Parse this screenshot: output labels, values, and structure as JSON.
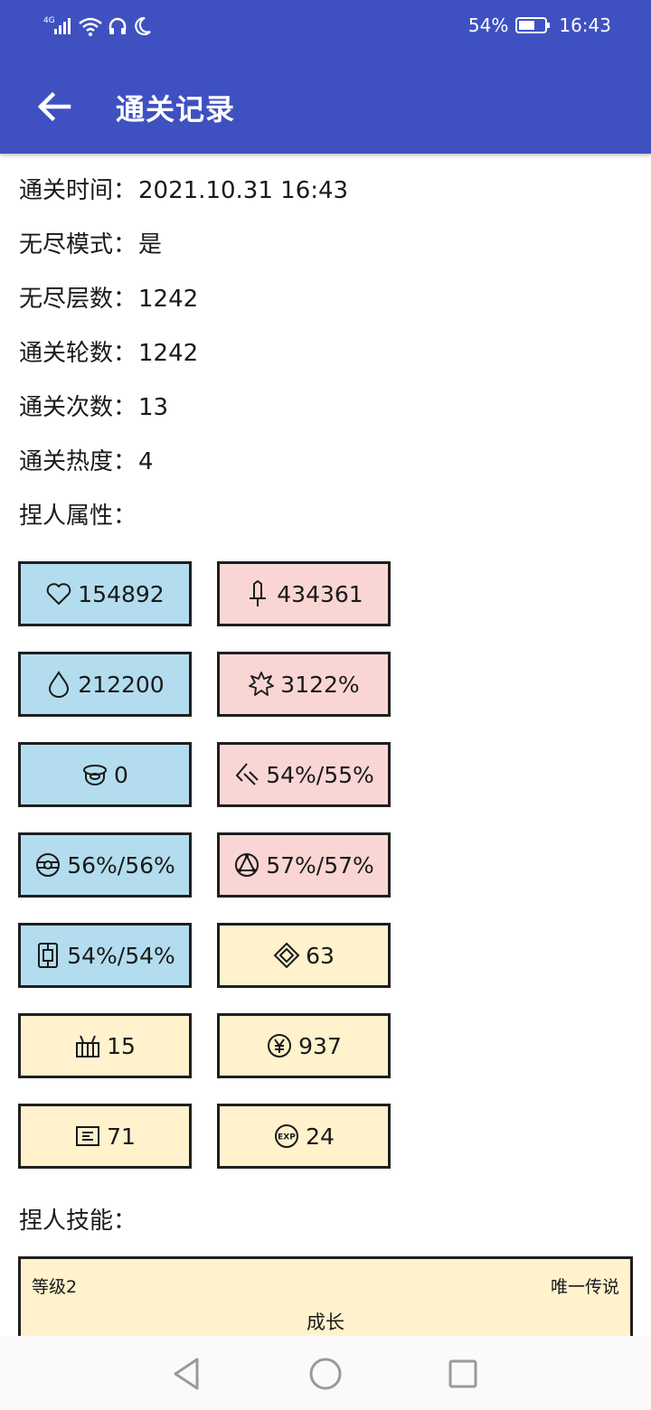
{
  "status_bar": {
    "network": "4G",
    "battery": "54%",
    "time": "16:43"
  },
  "app_bar": {
    "title": "通关记录",
    "back_icon": "arrow-left-icon"
  },
  "info": [
    {
      "label": "通关时间：",
      "value": "2021.10.31 16:43"
    },
    {
      "label": "无尽模式：",
      "value": "是"
    },
    {
      "label": "无尽层数：",
      "value": "1242"
    },
    {
      "label": "通关轮数：",
      "value": "1242"
    },
    {
      "label": "通关次数：",
      "value": "13"
    },
    {
      "label": "通关热度：",
      "value": "4"
    }
  ],
  "attributes_label": "捏人属性：",
  "attributes": [
    {
      "icon": "heart-icon",
      "value": "154892",
      "color": "#b3ddee"
    },
    {
      "icon": "sword-icon",
      "value": "434361",
      "color": "#f9d6d4"
    },
    {
      "icon": "drop-icon",
      "value": "212200",
      "color": "#b3ddee"
    },
    {
      "icon": "burst-icon",
      "value": "3122%",
      "color": "#f9d6d4"
    },
    {
      "icon": "helmet-icon",
      "value": "0",
      "color": "#b3ddee"
    },
    {
      "icon": "slash-icon",
      "value": "54%/55%",
      "color": "#f9d6d4"
    },
    {
      "icon": "shield-ball-icon",
      "value": "56%/56%",
      "color": "#b3ddee"
    },
    {
      "icon": "triangle-circle-icon",
      "value": "57%/57%",
      "color": "#f9d6d4"
    },
    {
      "icon": "armor-plate-icon",
      "value": "54%/54%",
      "color": "#b3ddee"
    },
    {
      "icon": "diamond-icon",
      "value": "63",
      "color": "#fff2cd"
    },
    {
      "icon": "gift-box-icon",
      "value": "15",
      "color": "#fff2cd"
    },
    {
      "icon": "yen-coin-icon",
      "value": "937",
      "color": "#fff2cd"
    },
    {
      "icon": "card-icon",
      "value": "71",
      "color": "#fff2cd"
    },
    {
      "icon": "exp-icon",
      "value": "24",
      "color": "#fff2cd"
    }
  ],
  "skills_label": "捏人技能：",
  "skills": [
    {
      "level": "等级2",
      "rarity": "唯一传说",
      "name": "成长"
    }
  ],
  "colors": {
    "primary": "#3f51c1",
    "blue_card": "#b3ddee",
    "pink_card": "#f9d6d4",
    "yellow_card": "#fff2cd"
  }
}
